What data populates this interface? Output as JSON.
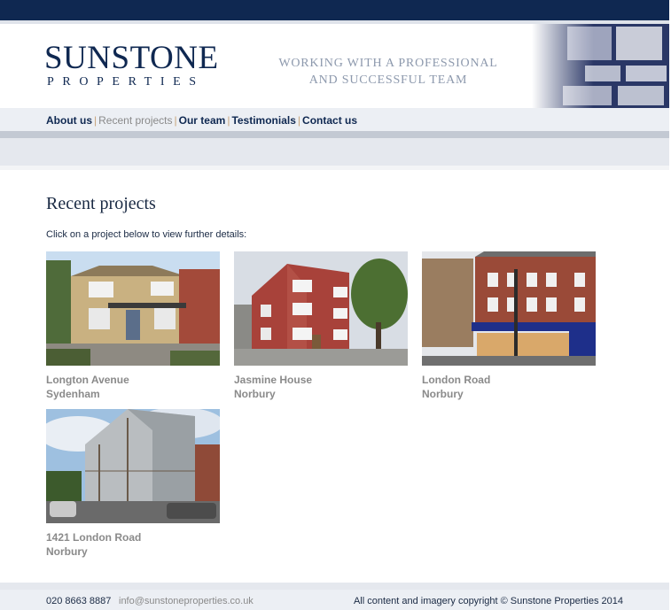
{
  "header": {
    "logo_main": "SUNSTONE",
    "logo_sub": "PROPERTIES",
    "tagline_line1": "WORKING WITH A PROFESSIONAL",
    "tagline_line2": "AND SUCCESSFUL TEAM"
  },
  "nav": {
    "items": [
      {
        "label": "About us",
        "active": false
      },
      {
        "label": "Recent projects",
        "active": true
      },
      {
        "label": "Our team",
        "active": false
      },
      {
        "label": "Testimonials",
        "active": false
      },
      {
        "label": "Contact us",
        "active": false
      }
    ],
    "separator": "|"
  },
  "main": {
    "title": "Recent projects",
    "intro": "Click on a project below to view further details:"
  },
  "projects": [
    {
      "name": "Longton Avenue",
      "area": "Sydenham"
    },
    {
      "name": "Jasmine House",
      "area": "Norbury"
    },
    {
      "name": "London Road",
      "area": "Norbury"
    },
    {
      "name": "1421 London Road",
      "area": "Norbury"
    }
  ],
  "footer": {
    "phone": "020 8663 8887",
    "email": "info@sunstoneproperties.co.uk",
    "copyright": "All content and imagery copyright © Sunstone Properties 2014"
  },
  "colors": {
    "brand_navy": "#0f2851",
    "muted_text": "#8a8a8a",
    "nav_separator": "#c8a47a"
  }
}
